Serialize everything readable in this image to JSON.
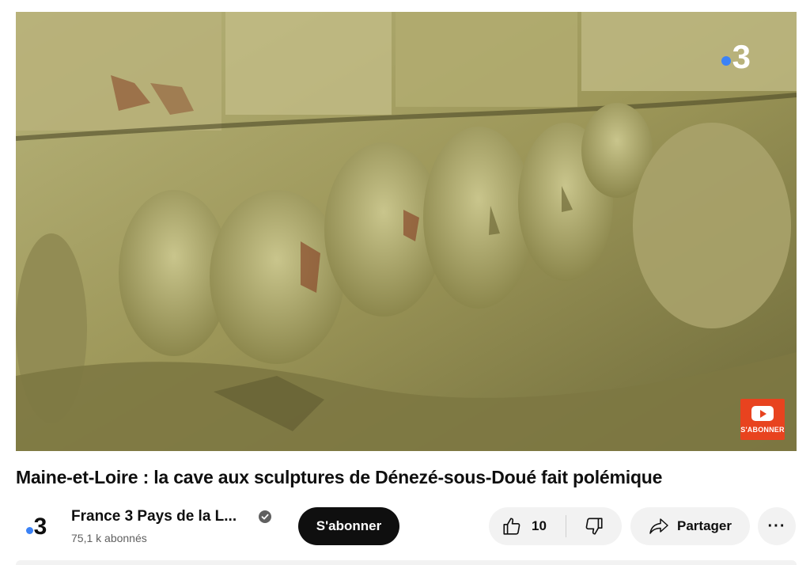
{
  "video": {
    "overlay_logo_text": "3",
    "subscribe_watermark_label": "S'ABONNER"
  },
  "title": "Maine-et-Loire : la cave aux sculptures de Dénezé-sous-Doué fait polémique",
  "channel": {
    "avatar_text": "3",
    "name": "France 3 Pays de la L...",
    "subscribers": "75,1 k abonnés",
    "verified": true
  },
  "actions": {
    "subscribe_label": "S'abonner",
    "like_count": "10",
    "share_label": "Partager",
    "more_label": "···"
  },
  "colors": {
    "accent_dot": "#3b82f6",
    "subscribe_bg": "#0f0f0f",
    "watermark_bg": "#e8431f"
  }
}
